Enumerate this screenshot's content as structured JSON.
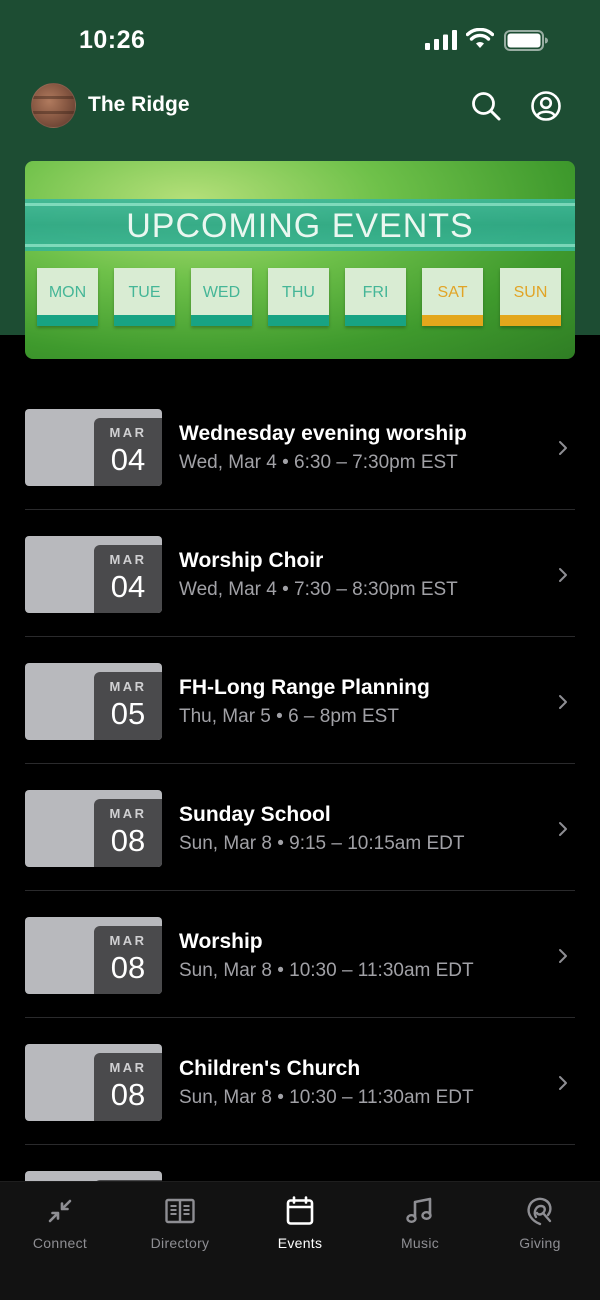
{
  "status_bar": {
    "time": "10:26"
  },
  "header": {
    "title": "The Ridge"
  },
  "banner": {
    "title": "UPCOMING EVENTS",
    "days": [
      "MON",
      "TUE",
      "WED",
      "THU",
      "FRI",
      "SAT",
      "SUN"
    ]
  },
  "events": [
    {
      "month": "MAR",
      "day": "04",
      "title": "Wednesday evening worship",
      "when": "Wed, Mar 4 • 6:30 – 7:30pm EST"
    },
    {
      "month": "MAR",
      "day": "04",
      "title": "Worship Choir",
      "when": "Wed, Mar 4 • 7:30 – 8:30pm EST"
    },
    {
      "month": "MAR",
      "day": "05",
      "title": "FH-Long Range Planning",
      "when": "Thu, Mar 5 • 6 – 8pm EST"
    },
    {
      "month": "MAR",
      "day": "08",
      "title": "Sunday School",
      "when": "Sun, Mar 8 • 9:15 – 10:15am EDT"
    },
    {
      "month": "MAR",
      "day": "08",
      "title": "Worship",
      "when": "Sun, Mar 8 • 10:30 – 11:30am EDT"
    },
    {
      "month": "MAR",
      "day": "08",
      "title": "Children's Church",
      "when": "Sun, Mar 8 • 10:30 – 11:30am EDT"
    }
  ],
  "tabs": [
    {
      "label": "Connect",
      "icon": "connect-arrows-icon"
    },
    {
      "label": "Directory",
      "icon": "book-icon"
    },
    {
      "label": "Events",
      "icon": "calendar-icon",
      "active": true
    },
    {
      "label": "Music",
      "icon": "music-note-icon"
    },
    {
      "label": "Giving",
      "icon": "giving-icon"
    }
  ],
  "colors": {
    "header_green": "#1d4d33",
    "background": "#000000",
    "date_chip": "#4a4a4c",
    "thumbnail": "#b8b9bd",
    "secondary_text": "#a1a1a6"
  }
}
